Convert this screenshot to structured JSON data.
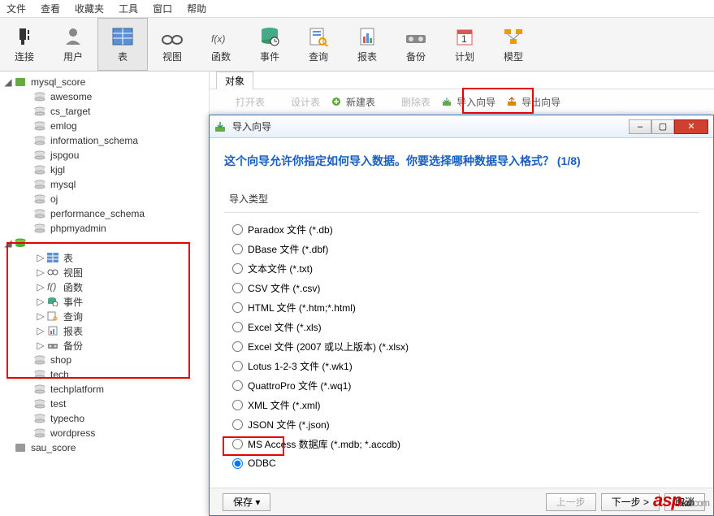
{
  "menu": [
    "文件",
    "查看",
    "收藏夹",
    "工具",
    "窗口",
    "帮助"
  ],
  "toolbar": [
    {
      "label": "连接",
      "icon": "plug"
    },
    {
      "label": "用户",
      "icon": "user"
    },
    {
      "label": "表",
      "icon": "table",
      "active": true
    },
    {
      "label": "视图",
      "icon": "view"
    },
    {
      "label": "函数",
      "icon": "fx"
    },
    {
      "label": "事件",
      "icon": "event"
    },
    {
      "label": "查询",
      "icon": "query"
    },
    {
      "label": "报表",
      "icon": "report"
    },
    {
      "label": "备份",
      "icon": "backup"
    },
    {
      "label": "计划",
      "icon": "schedule"
    },
    {
      "label": "模型",
      "icon": "model"
    }
  ],
  "tree": {
    "root": "mysql_score",
    "dbs": [
      "awesome",
      "cs_target",
      "emlog",
      "information_schema",
      "jspgou",
      "kjgl",
      "mysql",
      "oj",
      "performance_schema",
      "phpmyadmin"
    ],
    "expanded_icon": "db-open",
    "expanded_children": [
      {
        "label": "表",
        "icon": "table-sm"
      },
      {
        "label": "视图",
        "icon": "view-sm"
      },
      {
        "label": "函数",
        "icon": "fx-sm"
      },
      {
        "label": "事件",
        "icon": "event-sm"
      },
      {
        "label": "查询",
        "icon": "query-sm"
      },
      {
        "label": "报表",
        "icon": "report-sm"
      },
      {
        "label": "备份",
        "icon": "backup-sm"
      }
    ],
    "dbs2": [
      "shop",
      "tech",
      "techplatform",
      "test",
      "typecho",
      "wordpress"
    ],
    "root2": "sau_score"
  },
  "tab": "对象",
  "actions": [
    {
      "label": "打开表",
      "disabled": true
    },
    {
      "label": "设计表",
      "disabled": true
    },
    {
      "label": "新建表",
      "icon": "plus"
    },
    {
      "label": "删除表",
      "disabled": true
    },
    {
      "label": "导入向导",
      "icon": "import",
      "hl": true
    },
    {
      "label": "导出向导",
      "icon": "export"
    }
  ],
  "dialog": {
    "title": "导入向导",
    "heading": "这个向导允许你指定如何导入数据。你要选择哪种数据导入格式？ (1/8)",
    "group": "导入类型",
    "options": [
      "Paradox 文件 (*.db)",
      "DBase 文件 (*.dbf)",
      "文本文件 (*.txt)",
      "CSV 文件 (*.csv)",
      "HTML 文件 (*.htm;*.html)",
      "Excel 文件 (*.xls)",
      "Excel 文件 (2007 或以上版本) (*.xlsx)",
      "Lotus 1-2-3 文件 (*.wk1)",
      "QuattroPro 文件 (*.wq1)",
      "XML 文件 (*.xml)",
      "JSON 文件 (*.json)",
      "MS Access 数据库 (*.mdb; *.accdb)",
      "ODBC"
    ],
    "selected": 12,
    "buttons": {
      "save": "保存",
      "prev": "上一步",
      "next": "下一步 >",
      "cancel": "取消"
    }
  }
}
